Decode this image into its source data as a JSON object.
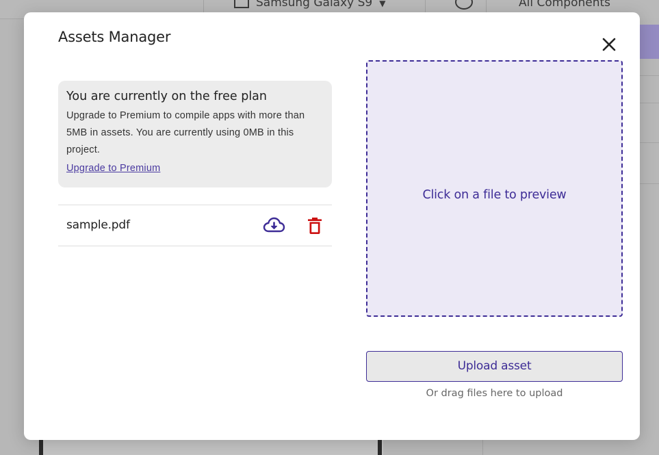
{
  "background": {
    "device_label": "Samsung Galaxy S9",
    "components_label": "All Components"
  },
  "modal": {
    "title": "Assets Manager",
    "close_icon": "close-icon"
  },
  "plan_notice": {
    "title": "You are currently on the free plan",
    "description": "Upgrade to Premium to compile apps with more than 5MB in assets. You are currently using 0MB in this project.",
    "link_label": "Upgrade to Premium"
  },
  "files": [
    {
      "name": "sample.pdf",
      "download_icon": "cloud-download-icon",
      "delete_icon": "trash-icon"
    }
  ],
  "preview": {
    "placeholder": "Click on a file to preview"
  },
  "upload": {
    "button_label": "Upload asset",
    "hint": "Or drag files here to upload"
  },
  "colors": {
    "accent": "#3d2c96",
    "danger": "#cc1111",
    "preview_bg": "#ece9f6",
    "card_bg": "#ececec"
  }
}
